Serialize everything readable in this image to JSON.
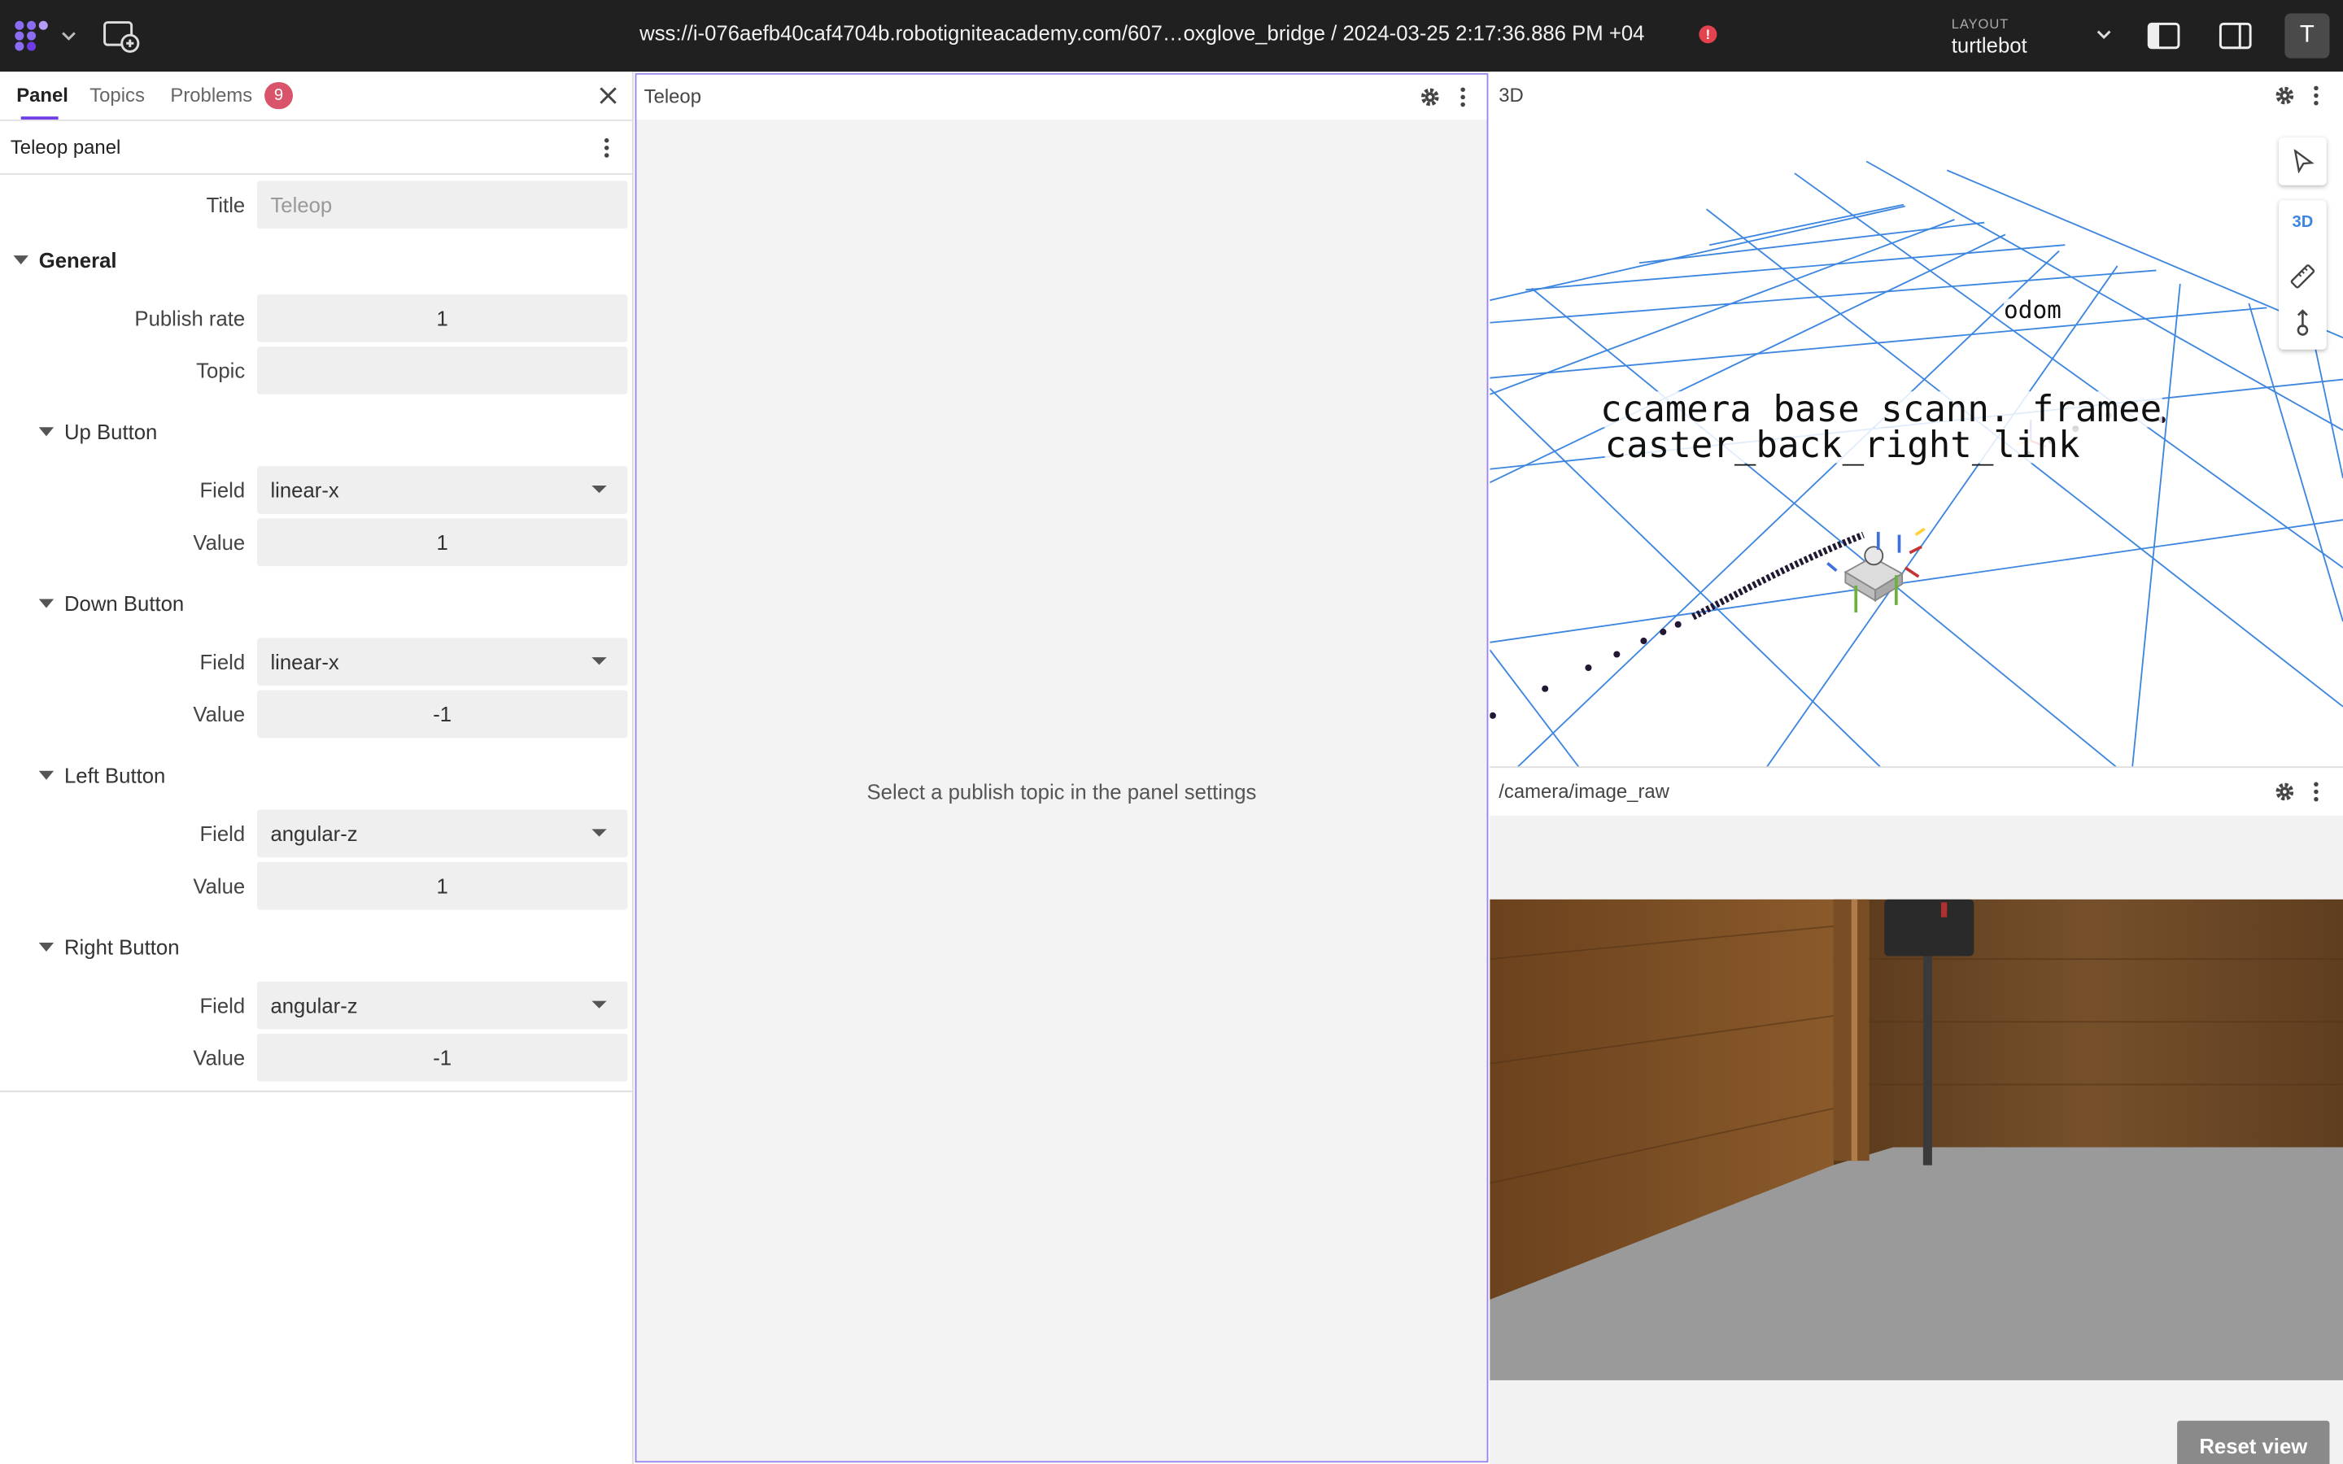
{
  "topbar": {
    "logo_icon": "foxglove-logo-icon",
    "connection": "wss://i-076aefb40caf4704b.robotigniteacademy.com/607…oxglove_bridge / 2024-03-25 2:17:36.886 PM +04",
    "alert_symbol": "!",
    "layout_label": "LAYOUT",
    "layout_name": "turtlebot",
    "avatar_initial": "T"
  },
  "sidebar": {
    "tabs": [
      {
        "label": "Panel"
      },
      {
        "label": "Topics"
      },
      {
        "label": "Problems"
      }
    ],
    "problems_count": "9",
    "panel_title": "Teleop panel",
    "title_label": "Title",
    "title_placeholder": "Teleop",
    "general": {
      "label": "General",
      "publish_rate_label": "Publish rate",
      "publish_rate": "1",
      "topic_label": "Topic",
      "topic_value": ""
    },
    "buttons": [
      {
        "section": "Up Button",
        "field_label": "Field",
        "field": "linear-x",
        "value_label": "Value",
        "value": "1"
      },
      {
        "section": "Down Button",
        "field_label": "Field",
        "field": "linear-x",
        "value_label": "Value",
        "value": "-1"
      },
      {
        "section": "Left Button",
        "field_label": "Field",
        "field": "angular-z",
        "value_label": "Value",
        "value": "1"
      },
      {
        "section": "Right Button",
        "field_label": "Field",
        "field": "angular-z",
        "value_label": "Value",
        "value": "-1"
      }
    ]
  },
  "teleop": {
    "title": "Teleop",
    "message": "Select a publish topic in the panel settings"
  },
  "threed": {
    "title": "3D",
    "mode_label": "3D",
    "frames": {
      "odom": "odom",
      "overlap_line": "ccamera base scann. framee",
      "caster": "caster_back_right_link"
    }
  },
  "image": {
    "topic": "/camera/image_raw",
    "reset_label": "Reset view"
  },
  "colors": {
    "accent": "#6f3be8",
    "grid": "#3d86e0",
    "problems_badge": "#d9536b",
    "error_dot": "#e3424f"
  }
}
